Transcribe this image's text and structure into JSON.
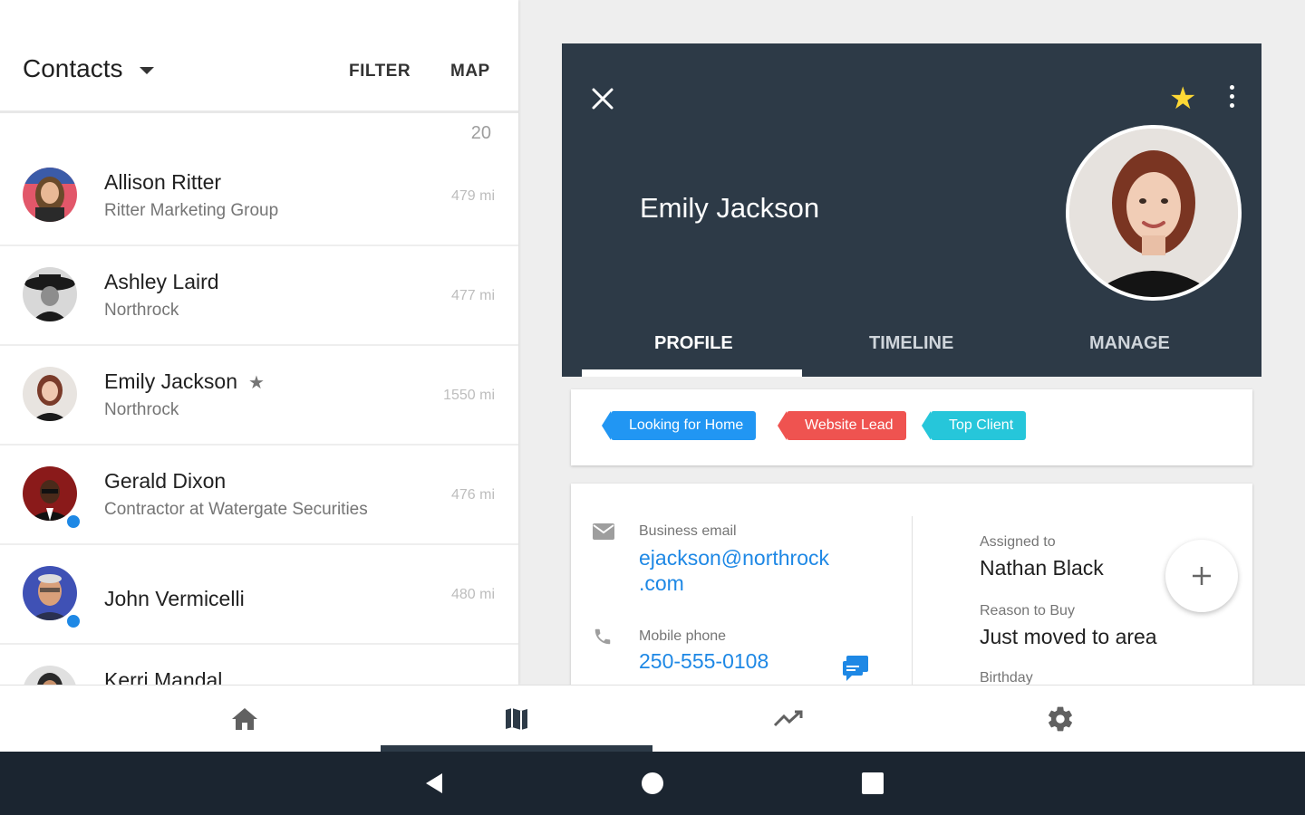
{
  "header": {
    "title": "Contacts",
    "filter_label": "FILTER",
    "map_label": "MAP",
    "count": "20"
  },
  "contacts": [
    {
      "name": "Allison Ritter",
      "company": "Ritter Marketing Group",
      "distance": "479 mi"
    },
    {
      "name": "Ashley Laird",
      "company": "Northrock",
      "distance": "477 mi"
    },
    {
      "name": "Emily Jackson",
      "company": "Northrock",
      "distance": "1550 mi",
      "starred": "★"
    },
    {
      "name": "Gerald Dixon",
      "company": "Contractor at Watergate Securities",
      "distance": "476 mi"
    },
    {
      "name": "John Vermicelli",
      "company": "",
      "distance": "480 mi"
    },
    {
      "name": "Kerri Mandal",
      "company": "",
      "distance": ""
    }
  ],
  "detail": {
    "name": "Emily Jackson",
    "tabs": [
      "PROFILE",
      "TIMELINE",
      "MANAGE"
    ],
    "tags": [
      {
        "label": "Looking for Home",
        "color": "#2196f3"
      },
      {
        "label": "Website Lead",
        "color": "#ef5350"
      },
      {
        "label": "Top Client",
        "color": "#26c6da"
      }
    ],
    "email_label": "Business email",
    "email_line1": "ejackson@northrock",
    "email_line2": ".com",
    "phone_label": "Mobile phone",
    "phone_value": "250-555-0108",
    "assigned_label": "Assigned to",
    "assigned_value": "Nathan Black",
    "reason_label": "Reason to Buy",
    "reason_value": "Just moved to area",
    "birthday_label": "Birthday"
  },
  "colors": {
    "header_bg": "#2d3a47",
    "accent_blue": "#1e88e5",
    "star": "#fdd835"
  },
  "nav": [
    "home-icon",
    "map-icon",
    "trending-icon",
    "gear-icon"
  ]
}
